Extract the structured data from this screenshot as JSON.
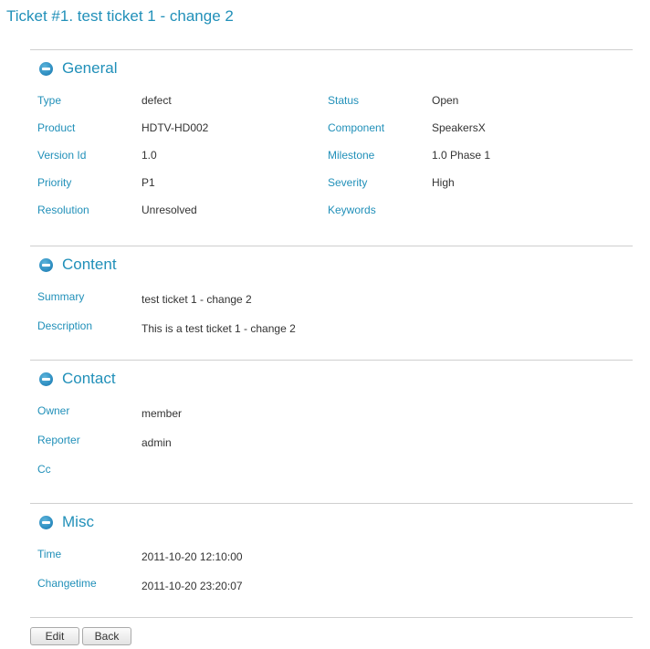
{
  "page": {
    "title": "Ticket #1. test ticket 1 - change 2"
  },
  "general": {
    "heading": "General",
    "type": {
      "label": "Type",
      "value": "defect"
    },
    "status": {
      "label": "Status",
      "value": "Open"
    },
    "product": {
      "label": "Product",
      "value": "HDTV-HD002"
    },
    "component": {
      "label": "Component",
      "value": "SpeakersX"
    },
    "version": {
      "label": "Version Id",
      "value": "1.0"
    },
    "milestone": {
      "label": "Milestone",
      "value": "1.0 Phase 1"
    },
    "priority": {
      "label": "Priority",
      "value": "P1"
    },
    "severity": {
      "label": "Severity",
      "value": "High"
    },
    "resolution": {
      "label": "Resolution",
      "value": "Unresolved"
    },
    "keywords": {
      "label": "Keywords",
      "value": ""
    }
  },
  "content": {
    "heading": "Content",
    "summary": {
      "label": "Summary",
      "value": "test ticket 1 - change 2"
    },
    "description": {
      "label": "Description",
      "value": "This is a test ticket 1 - change 2"
    }
  },
  "contact": {
    "heading": "Contact",
    "owner": {
      "label": "Owner",
      "value": "member"
    },
    "reporter": {
      "label": "Reporter",
      "value": "admin"
    },
    "cc": {
      "label": "Cc",
      "value": ""
    }
  },
  "misc": {
    "heading": "Misc",
    "time": {
      "label": "Time",
      "value": "2011-10-20 12:10:00"
    },
    "changetime": {
      "label": "Changetime",
      "value": "2011-10-20 23:20:07"
    }
  },
  "buttons": {
    "edit": "Edit",
    "back": "Back"
  },
  "colors": {
    "accent": "#2190b9",
    "text": "#333333",
    "rule": "#cfcfcf"
  },
  "icons": {
    "section_toggle": "minus-circle-icon"
  }
}
